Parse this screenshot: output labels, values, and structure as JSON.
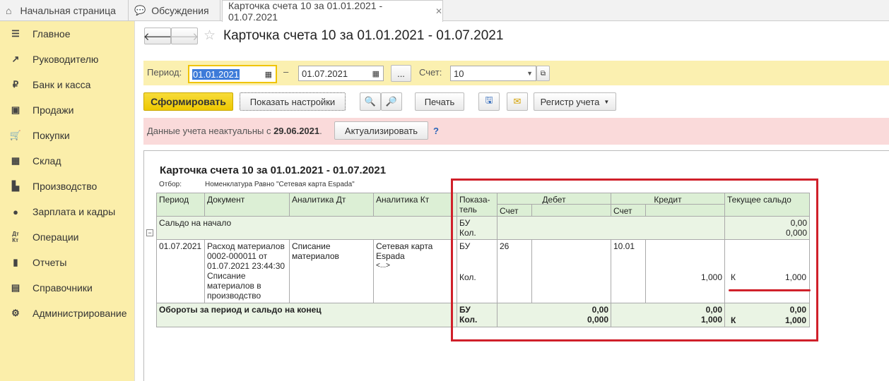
{
  "tabs": {
    "home": "Начальная страница",
    "discussions": "Обсуждения",
    "active": "Карточка счета 10 за 01.01.2021 - 01.07.2021"
  },
  "sidebar": {
    "items": [
      {
        "label": "Главное",
        "icon": "menu-icon"
      },
      {
        "label": "Руководителю",
        "icon": "trend-icon"
      },
      {
        "label": "Банк и касса",
        "icon": "ruble-icon"
      },
      {
        "label": "Продажи",
        "icon": "bag-icon"
      },
      {
        "label": "Покупки",
        "icon": "cart-icon"
      },
      {
        "label": "Склад",
        "icon": "grid-icon"
      },
      {
        "label": "Производство",
        "icon": "factory-icon"
      },
      {
        "label": "Зарплата и кадры",
        "icon": "person-icon"
      },
      {
        "label": "Операции",
        "icon": "dt-kt-icon"
      },
      {
        "label": "Отчеты",
        "icon": "bar-chart-icon"
      },
      {
        "label": "Справочники",
        "icon": "book-icon"
      },
      {
        "label": "Администрирование",
        "icon": "gear-icon"
      }
    ]
  },
  "header": {
    "title": "Карточка счета 10 за 01.01.2021 - 01.07.2021"
  },
  "params": {
    "period_label": "Период:",
    "date_from": "01.01.2021",
    "dash": "–",
    "date_to": "01.07.2021",
    "dots": "...",
    "account_label": "Счет:",
    "account_value": "10"
  },
  "toolbar": {
    "generate": "Сформировать",
    "show_settings": "Показать настройки",
    "print": "Печать",
    "register": "Регистр учета"
  },
  "warning": {
    "text": "Данные учета неактуальны с ",
    "date": "29.06.2021",
    "dot": ".",
    "button": "Актуализировать",
    "help": "?"
  },
  "report": {
    "title": "Карточка счета 10 за 01.01.2021 - 01.07.2021",
    "filter_label": "Отбор:",
    "filter_value": "Номенклатура Равно \"Сетевая карта Espada\"",
    "headers": {
      "period": "Период",
      "document": "Документ",
      "an_dt": "Аналитика Дт",
      "an_kt": "Аналитика Кт",
      "indicator": "Показа-тель",
      "debit": "Дебет",
      "credit": "Кредит",
      "balance": "Текущее сальдо",
      "account": "Счет"
    },
    "opening": {
      "label": "Сальдо на начало",
      "bu": "БУ",
      "kol": "Кол.",
      "bal_bu": "0,00",
      "bal_kol": "0,000"
    },
    "row": {
      "period": "01.07.2021",
      "document": "Расход материалов 0002-000011 от 01.07.2021 23:44:30 Списание материалов в производство",
      "an_dt": "Списание материалов",
      "an_kt": "Сетевая карта Espada",
      "an_kt_more": "<...>",
      "bu": "БУ",
      "kol": "Кол.",
      "debit_account": "26",
      "credit_account": "10.01",
      "credit_kol": "1,000",
      "bal_side": "К",
      "bal_kol": "1,000"
    },
    "totals": {
      "label": "Обороты за период и сальдо на конец",
      "bu": "БУ",
      "kol": "Кол.",
      "debit_bu": "0,00",
      "debit_kol": "0,000",
      "credit_bu": "0,00",
      "credit_kol": "1,000",
      "bal_bu": "0,00",
      "bal_side": "К",
      "bal_kol": "1,000"
    }
  },
  "colors": {
    "highlight_box": "#d0202a",
    "sidebar_bg": "#fbeeaa",
    "generate_btn": "#f2d21a"
  }
}
